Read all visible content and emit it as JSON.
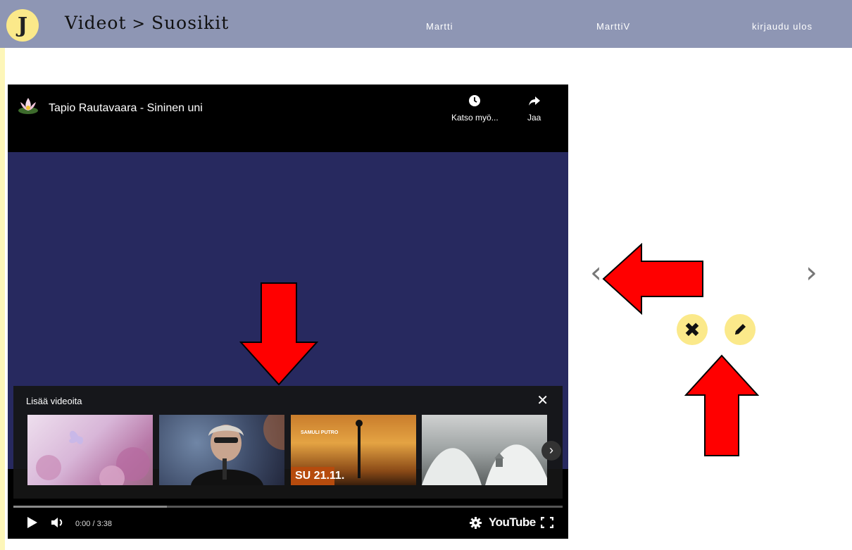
{
  "header": {
    "logo_letter": "J",
    "breadcrumb": {
      "section": "Videot",
      "separator": ">",
      "current": "Suosikit"
    },
    "links": [
      "Martti",
      "MarttiV",
      "kirjaudu ulos"
    ]
  },
  "video": {
    "title": "Tapio Rautavaara - Sininen uni",
    "watch_later_label": "Katso myö...",
    "share_label": "Jaa",
    "more_videos_title": "Lisää videoita",
    "thumb3_badge": "SU 21.11.",
    "thumb3_line": "SAMULI PUTRO",
    "time": "0:00 / 3:38",
    "progress_buffered": 0.28,
    "brand": "YouTube"
  },
  "icons": {
    "prev": "chevron-left-icon",
    "next": "chevron-right-icon",
    "delete": "close-icon",
    "edit": "pencil-icon"
  },
  "colors": {
    "page_bg": "#fdf6b9",
    "topbar": "#8e96b4",
    "accent": "#fbe98a",
    "annotation_arrow": "#ff0000",
    "video_stage": "#27295f"
  }
}
